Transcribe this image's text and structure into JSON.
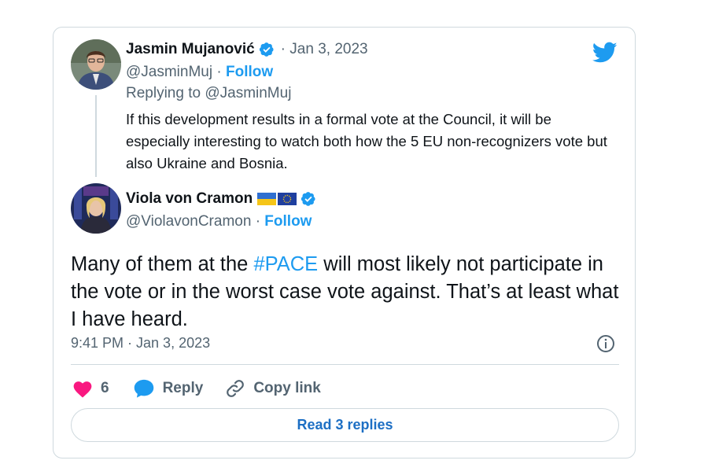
{
  "parent_tweet": {
    "author_name": "Jasmin Mujanović",
    "date": "· Jan 3, 2023",
    "handle": "@JasminMuj",
    "separator": "·",
    "follow_label": "Follow",
    "replying_to": "Replying to @JasminMuj",
    "text": "If this development results in a formal vote at the Council, it will be especially interesting to watch both how the 5 EU non-recognizers vote but also Ukraine and Bosnia."
  },
  "main_tweet": {
    "author_name": "Viola von Cramon",
    "handle": "@ViolavonCramon",
    "separator": "·",
    "follow_label": "Follow",
    "text_before": "Many of them at the ",
    "hashtag": "#PACE",
    "text_after": " will most likely not participate in the vote or in the worst case vote against. That’s at least what I have heard.",
    "timestamp": "9:41 PM · Jan 3, 2023"
  },
  "actions": {
    "like_count": "6",
    "reply_label": "Reply",
    "copy_link_label": "Copy link"
  },
  "read_replies_label": "Read 3 replies",
  "icons": [
    "twitter-bird-icon",
    "verified-badge-icon",
    "ukraine-flag-icon",
    "eu-flag-icon",
    "info-icon",
    "heart-icon",
    "reply-bubble-icon",
    "link-icon"
  ],
  "colors": {
    "accent": "#1d9bf0",
    "like": "#f91880",
    "muted": "#536471",
    "border": "#cfd9de"
  }
}
